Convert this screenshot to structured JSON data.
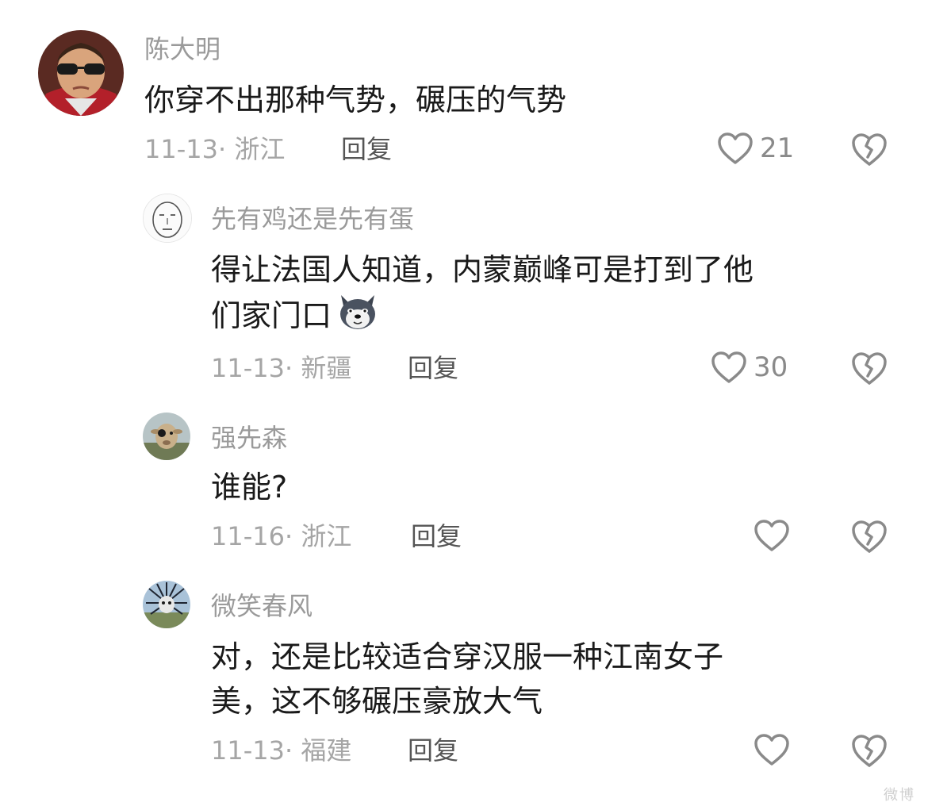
{
  "comments": [
    {
      "username": "陈大明",
      "lines": [
        "你穿不出那种气势，碾压的气势"
      ],
      "date": "11-13",
      "location": "浙江",
      "reply": "回复",
      "likes": "21",
      "avatar_icon": "sunglasses-boy-avatar"
    },
    {
      "username": "先有鸡还是先有蛋",
      "lines": [
        "得让法国人知道，内蒙巅峰可是打到了他",
        "们家门口"
      ],
      "date": "11-13",
      "location": "新疆",
      "reply": "回复",
      "likes": "30",
      "avatar_icon": "meme-face-avatar",
      "emoji": "husky-dog-emoji"
    },
    {
      "username": "强先森",
      "lines": [
        "谁能?"
      ],
      "date": "11-16",
      "location": "浙江",
      "reply": "回复",
      "likes": "",
      "avatar_icon": "sheep-avatar"
    },
    {
      "username": "微笑春风",
      "lines": [
        "对，还是比较适合穿汉服一种江南女子",
        "美，这不够碾压豪放大气"
      ],
      "date": "11-13",
      "location": "福建",
      "reply": "回复",
      "likes": "",
      "avatar_icon": "spiky-character-avatar"
    }
  ],
  "watermark": "微博"
}
